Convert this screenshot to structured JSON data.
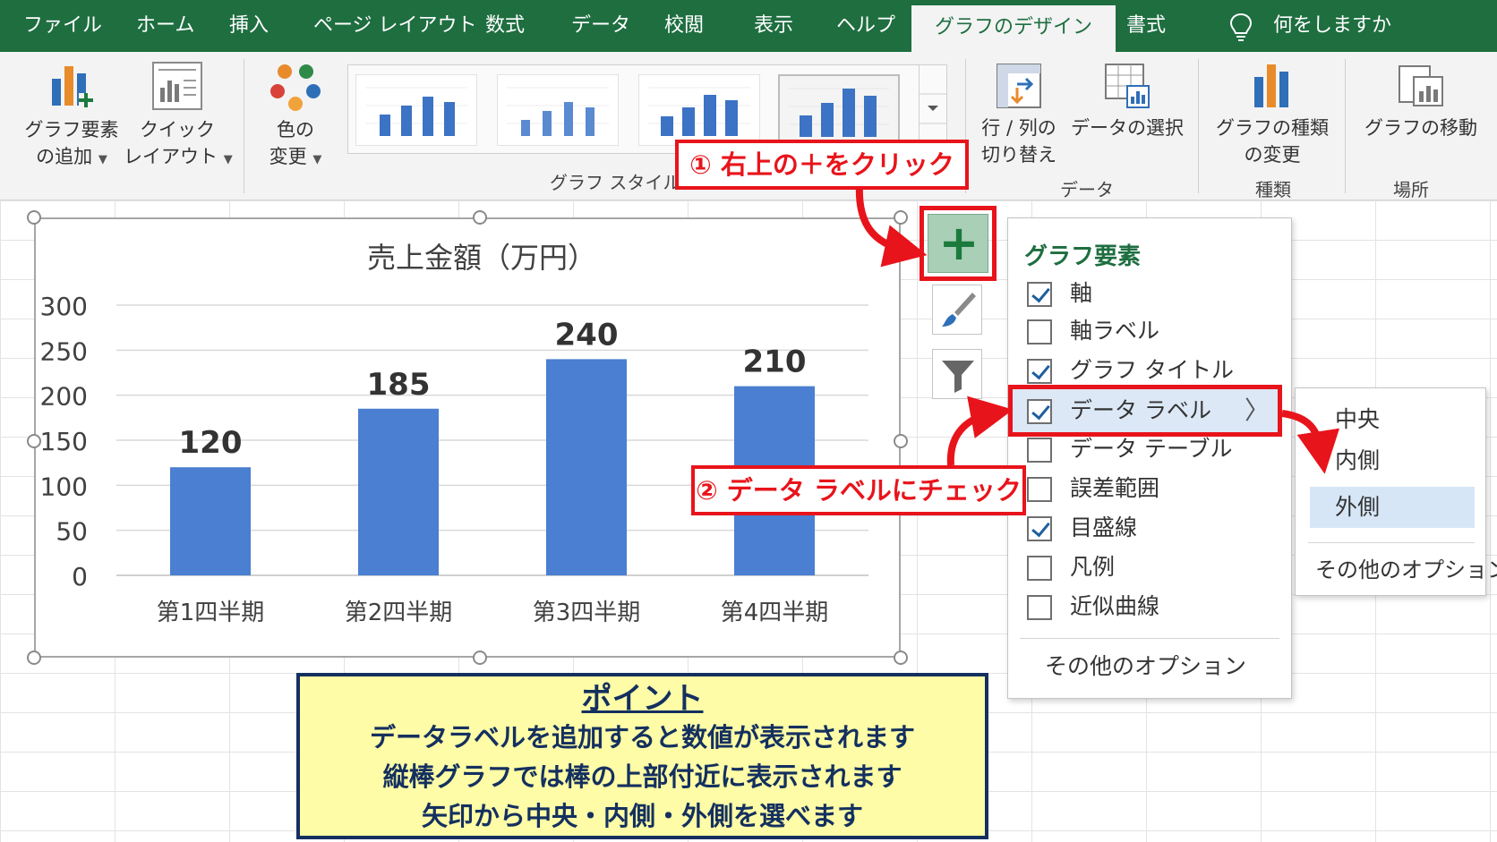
{
  "tabs": [
    {
      "label": "ファイル"
    },
    {
      "label": "ホーム"
    },
    {
      "label": "挿入"
    },
    {
      "label": "ページ レイアウト"
    },
    {
      "label": "数式"
    },
    {
      "label": "データ"
    },
    {
      "label": "校閲"
    },
    {
      "label": "表示"
    },
    {
      "label": "ヘルプ"
    },
    {
      "label": "グラフのデザイン",
      "active": true
    },
    {
      "label": "書式"
    }
  ],
  "tell_me": "何をしますか",
  "ribbon": {
    "add_element": {
      "line1": "グラフ要素",
      "line2": "の追加"
    },
    "quick_layout": {
      "line1": "クイック",
      "line2": "レイアウト"
    },
    "change_color": {
      "line1": "色の",
      "line2": "変更"
    },
    "chart_styles_group": "グラフ スタイル",
    "switch_row_col": {
      "line1": "行 / 列の",
      "line2": "切り替え"
    },
    "select_data": "データの選択",
    "data_group": "データ",
    "change_type": {
      "line1": "グラフの種類",
      "line2": "の変更"
    },
    "type_group": "種類",
    "move_chart": "グラフの移動",
    "location_group": "場所"
  },
  "chart_data": {
    "type": "bar",
    "title": "売上金額（万円）",
    "categories": [
      "第1四半期",
      "第2四半期",
      "第3四半期",
      "第4四半期"
    ],
    "values": [
      120,
      185,
      240,
      210
    ],
    "data_labels": [
      "120",
      "185",
      "240",
      "210"
    ],
    "ylim": [
      0,
      300
    ],
    "yticks": [
      0,
      50,
      100,
      150,
      200,
      250,
      300
    ],
    "ytick_labels": [
      "0",
      "50",
      "100",
      "150",
      "200",
      "250",
      "300"
    ],
    "xlabel": "",
    "ylabel": "",
    "grid": true,
    "bar_color": "#4a7fd1"
  },
  "chart_elements_panel": {
    "title": "グラフ要素",
    "items": [
      {
        "label": "軸",
        "checked": true
      },
      {
        "label": "軸ラベル",
        "checked": false
      },
      {
        "label": "グラフ タイトル",
        "checked": true
      },
      {
        "label": "データ ラベル",
        "checked": true
      },
      {
        "label": "データ テーブル",
        "checked": false
      },
      {
        "label": "誤差範囲",
        "checked": false
      },
      {
        "label": "目盛線",
        "checked": true
      },
      {
        "label": "凡例",
        "checked": false
      },
      {
        "label": "近似曲線",
        "checked": false
      }
    ],
    "more_options": "その他のオプション"
  },
  "data_label_submenu": {
    "items": [
      {
        "label": "中央",
        "selected": false
      },
      {
        "label": "内側",
        "selected": false
      },
      {
        "label": "外側",
        "selected": true
      }
    ],
    "more_options": "その他のオプション"
  },
  "callouts": {
    "step1": "① 右上の＋をクリック",
    "step2": "② データ ラベルにチェック"
  },
  "point": {
    "title": "ポイント",
    "lines": [
      "データラベルを追加すると数値が表示されます",
      "縦棒グラフでは棒の上部付近に表示されます",
      "矢印から中央・内側・外側を選べます"
    ]
  },
  "colors": {
    "accent_green": "#1e6e40",
    "callout_red": "#e8141b",
    "point_bg": "#fefca6",
    "point_text": "#14305f",
    "bar_blue": "#4a7fd1"
  }
}
